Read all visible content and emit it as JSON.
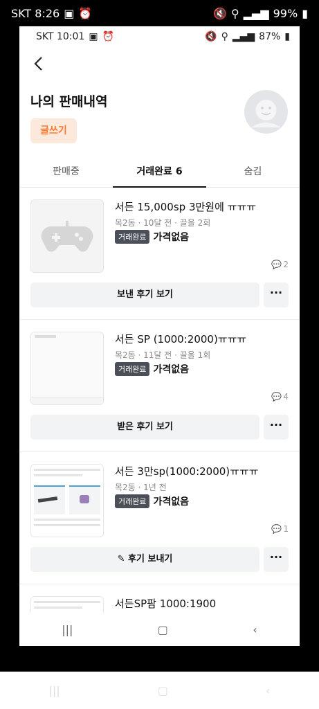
{
  "outer_status": {
    "carrier_time": "SKT 8:26",
    "battery": "99%"
  },
  "inner_status": {
    "carrier_time": "SKT 10:01",
    "battery": "87%"
  },
  "header": {
    "title": "나의 판매내역",
    "write_label": "글쓰기"
  },
  "tabs": [
    {
      "label": "판매중"
    },
    {
      "label": "거래완료 6"
    },
    {
      "label": "숨김"
    }
  ],
  "items": [
    {
      "title": "서든 15,000sp 3만원에 ㅠㅠㅠ",
      "meta": "목2동 · 10달 전 · 끌올 2회",
      "badge": "거래완료",
      "price": "가격없음",
      "chat_count": "2",
      "review_label": "보낸 후기 보기"
    },
    {
      "title": "서든 SP (1000:2000)ㅠㅠㅠ",
      "meta": "목2동 · 11달 전 · 끌올 1회",
      "badge": "거래완료",
      "price": "가격없음",
      "chat_count": "4",
      "review_label": "받은 후기 보기"
    },
    {
      "title": "서든 3만sp(1000:2000)ㅠㅠㅠ",
      "meta": "목2동 · 1년 전",
      "badge": "거래완료",
      "price": "가격없음",
      "chat_count": "1",
      "review_label": "후기 보내기"
    },
    {
      "title": "서든SP팜 1000:1900"
    }
  ],
  "icons": {
    "back": "chevron-left-icon",
    "more": "ellipsis-icon",
    "chat": "chat-bubble-icon",
    "pencil": "pencil-icon",
    "game": "gamepad-icon"
  },
  "colors": {
    "accent": "#ff7a2f",
    "accent_bg": "#fde9dc",
    "badge_bg": "#4a4f58"
  }
}
